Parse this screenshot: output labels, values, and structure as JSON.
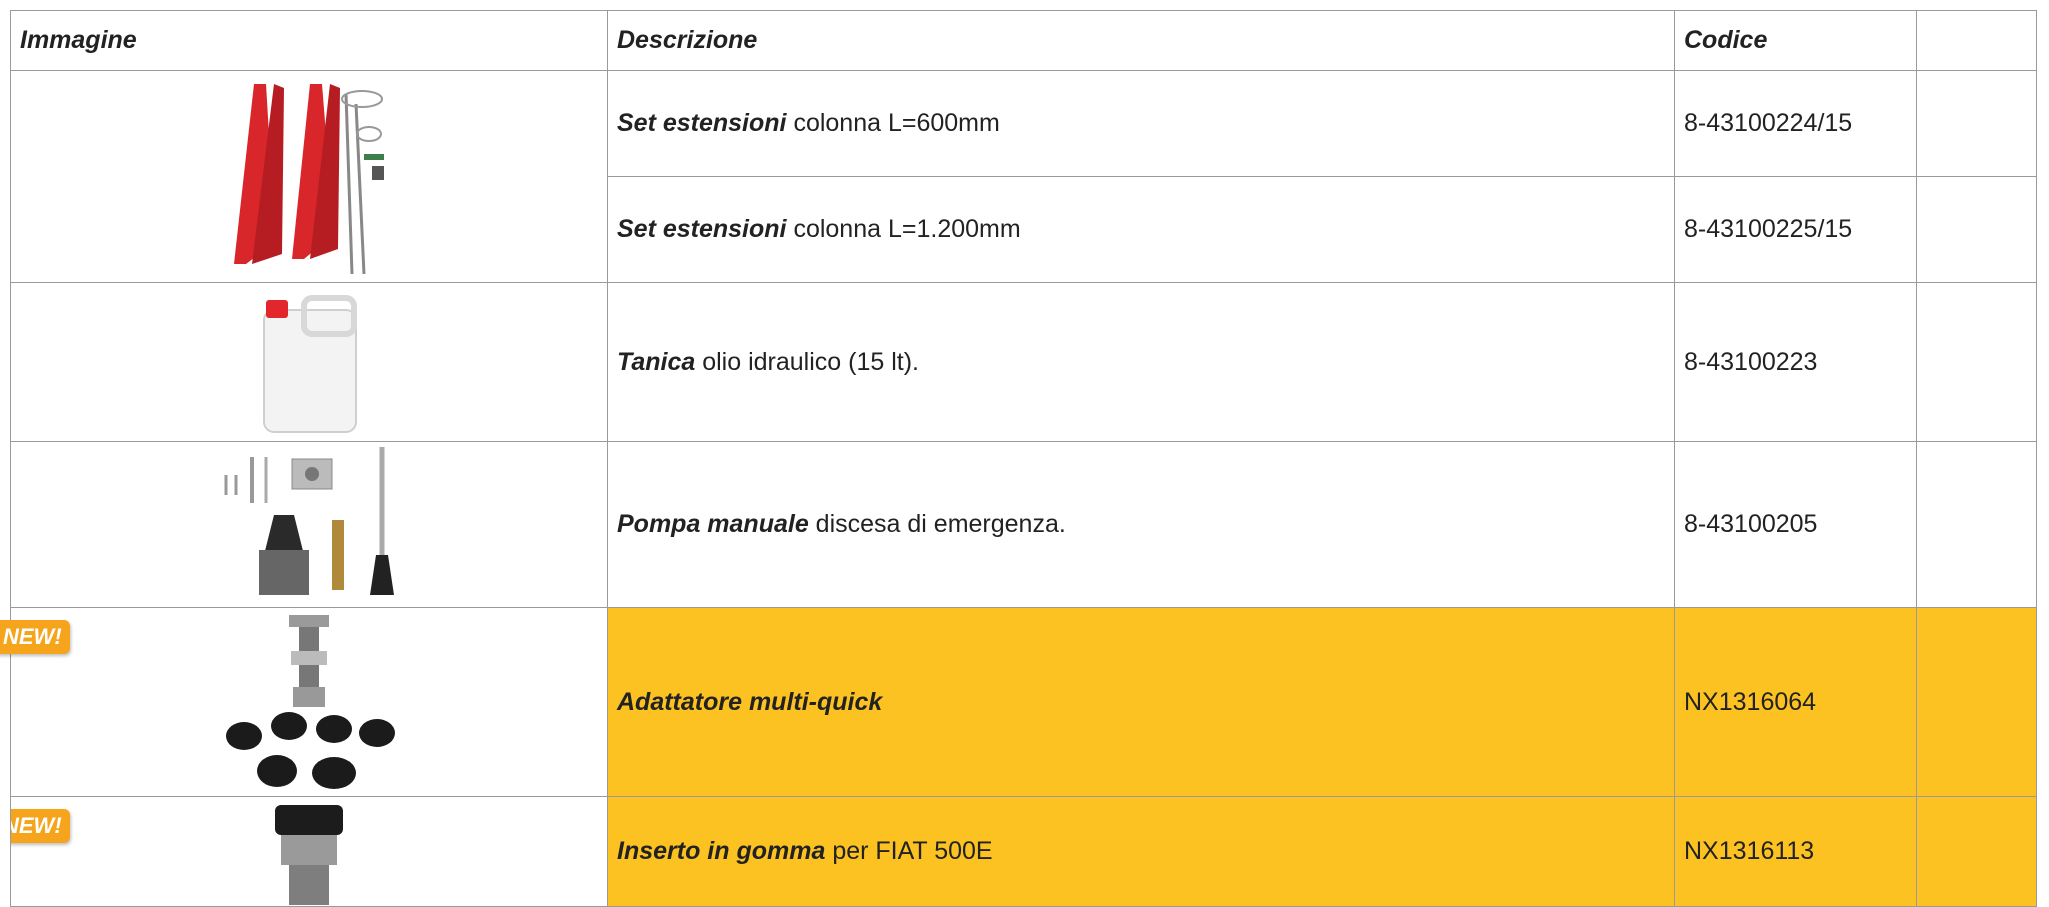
{
  "headers": {
    "image": "Immagine",
    "description": "Descrizione",
    "code": "Codice",
    "extra": ""
  },
  "badge": "NEW!",
  "rows": [
    {
      "kw": "Set estensioni",
      "rest": " colonna L=600mm",
      "code": "8-43100224/15"
    },
    {
      "kw": "Set estensioni",
      "rest": " colonna L=1.200mm",
      "code": "8-43100225/15"
    },
    {
      "kw": "Tanica",
      "rest": " olio idraulico (15 lt).",
      "code": "8-43100223"
    },
    {
      "kw": "Pompa manuale",
      "rest": " discesa di emergenza.",
      "code": "8-43100205"
    },
    {
      "kw": "Adattatore multi-quick",
      "rest": "",
      "code": "NX1316064"
    },
    {
      "kw": "Inserto in gomma",
      "rest": " per FIAT 500E",
      "code": "NX1316113"
    }
  ],
  "colors": {
    "highlight": "#fcc221",
    "badge": "#f5a41c",
    "border": "#9a9a9a"
  },
  "icons": [
    "column-extension-set-image",
    "hydraulic-oil-can-image",
    "manual-pump-kit-image",
    "multi-quick-adapter-image",
    "rubber-insert-image"
  ]
}
